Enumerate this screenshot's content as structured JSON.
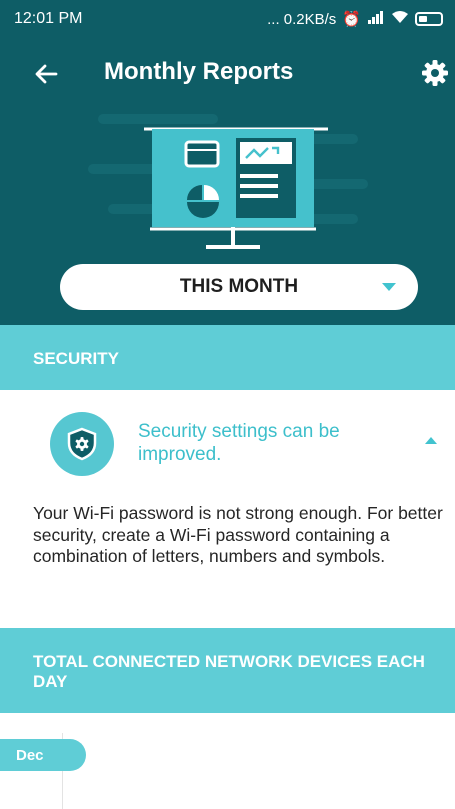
{
  "status_bar": {
    "time": "12:01 PM",
    "network_speed": "... 0.2KB/s",
    "icons": [
      "alarm-icon",
      "signal-icon",
      "wifi-icon",
      "battery-icon"
    ]
  },
  "header": {
    "title": "Monthly Reports",
    "back_icon": "back-arrow-icon",
    "settings_icon": "gear-icon"
  },
  "period_selector": {
    "selected": "THIS MONTH"
  },
  "security": {
    "section_title": "SECURITY",
    "alert_title": "Security settings can be improved.",
    "alert_body": "Your Wi-Fi password is not strong enough. For better security, create a Wi-Fi password containing a combination of letters, numbers and symbols."
  },
  "devices": {
    "section_title": "TOTAL CONNECTED NETWORK DEVICES EACH DAY",
    "month_label": "Dec"
  },
  "colors": {
    "dark_teal": "#0e5d66",
    "accent_teal": "#5fcdd6",
    "accent_text": "#3dbfcb"
  }
}
